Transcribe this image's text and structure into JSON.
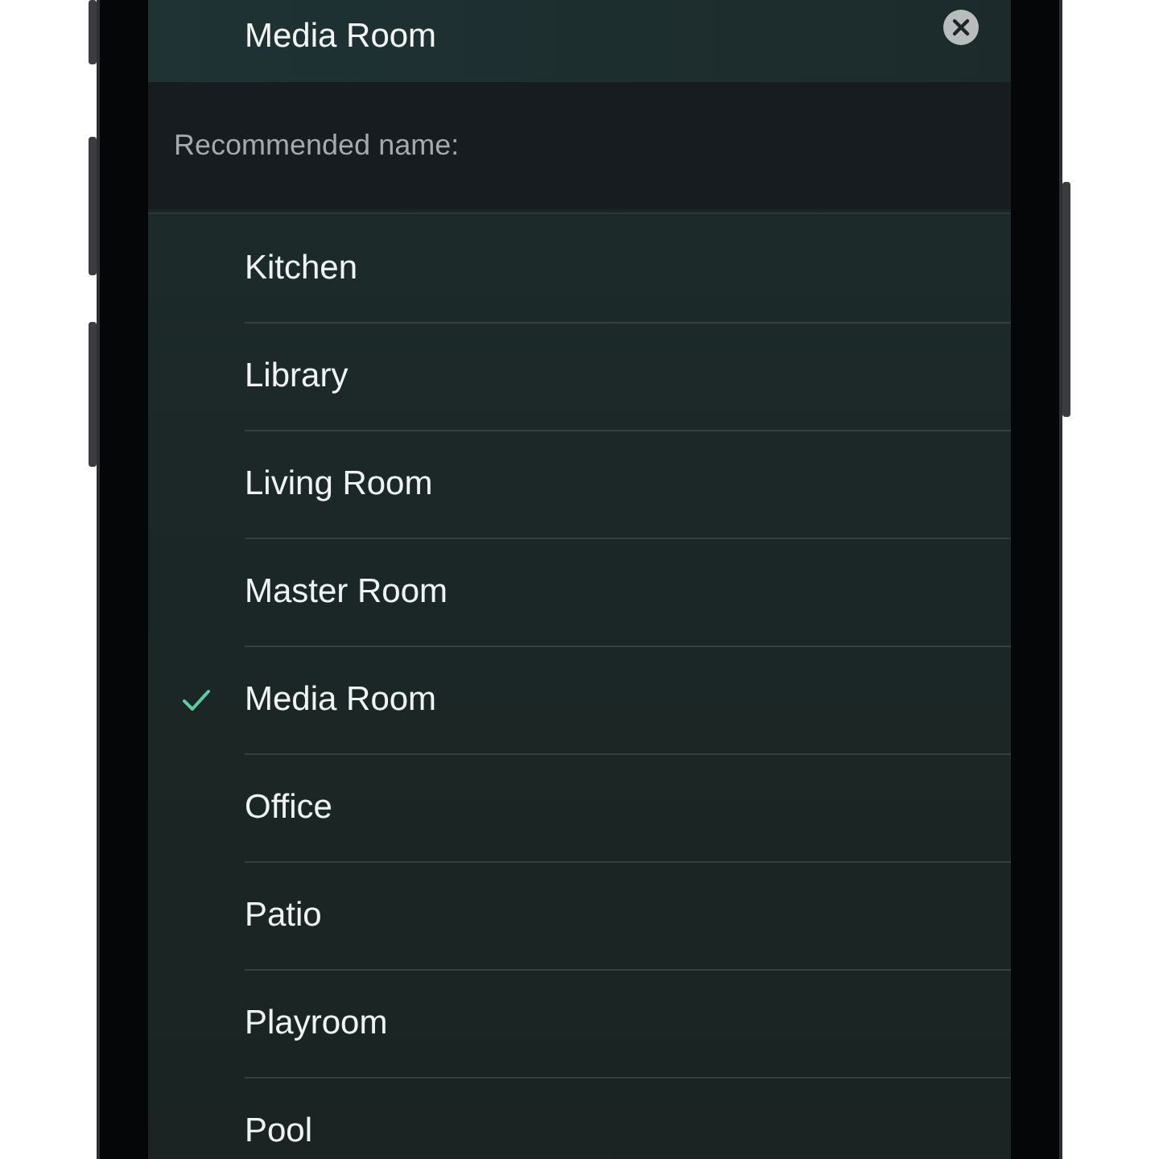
{
  "name_field": {
    "value": "Media Room"
  },
  "section_header": "Recommended name:",
  "rooms": [
    {
      "label": "Kitchen",
      "selected": false
    },
    {
      "label": "Library",
      "selected": false
    },
    {
      "label": "Living Room",
      "selected": false
    },
    {
      "label": "Master Room",
      "selected": false
    },
    {
      "label": "Media Room",
      "selected": true
    },
    {
      "label": "Office",
      "selected": false
    },
    {
      "label": "Patio",
      "selected": false
    },
    {
      "label": "Playroom",
      "selected": false
    },
    {
      "label": "Pool",
      "selected": false
    }
  ]
}
